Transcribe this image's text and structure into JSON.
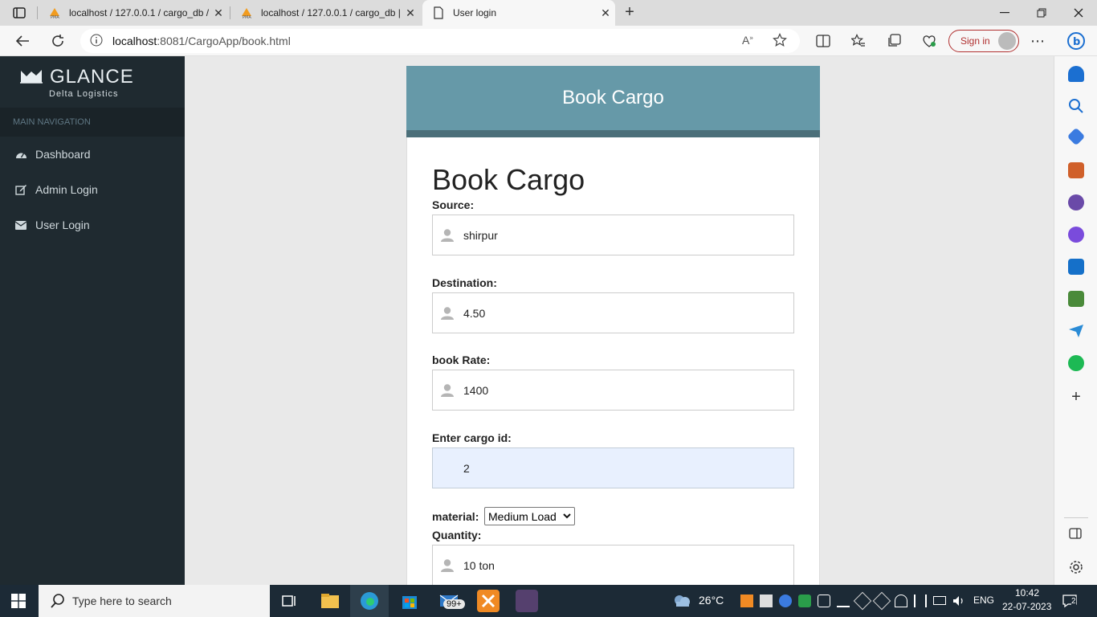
{
  "browser": {
    "tabs": [
      {
        "title": "localhost / 127.0.0.1 / cargo_db / "
      },
      {
        "title": "localhost / 127.0.0.1 / cargo_db | "
      },
      {
        "title": "User login"
      }
    ],
    "url_host": "localhost",
    "url_path": ":8081/CargoApp/book.html",
    "signin_label": "Sign in"
  },
  "sidebar": {
    "brand_name": "GLANCE",
    "brand_sub": "Delta Logistics",
    "section_label": "MAIN NAVIGATION",
    "items": [
      {
        "label": "Dashboard",
        "icon": "dashboard-icon"
      },
      {
        "label": "Admin Login",
        "icon": "edit-icon"
      },
      {
        "label": "User Login",
        "icon": "envelope-icon"
      }
    ]
  },
  "card": {
    "header": "Book Cargo",
    "form_title": "Book Cargo",
    "fields": [
      {
        "label": "Source:",
        "value": "shirpur"
      },
      {
        "label": "Destination:",
        "value": "4.50"
      },
      {
        "label": "book Rate:",
        "value": "1400"
      },
      {
        "label": "Enter cargo id:",
        "value": "2"
      }
    ],
    "material_label": "material:",
    "material_selected": "Medium Load",
    "quantity_label": "Quantity:",
    "quantity_value": "10 ton"
  },
  "taskbar": {
    "search_placeholder": "Type here to search",
    "mail_badge": "99+",
    "temperature": "26°C",
    "language": "ENG",
    "time": "10:42",
    "date": "22-07-2023",
    "notif_count": "2"
  },
  "colors": {
    "sidebar_bg": "#1f2a30",
    "card_header": "#6699a8",
    "card_strip": "#4b6f79",
    "autofill_bg": "#e8f0fe"
  }
}
